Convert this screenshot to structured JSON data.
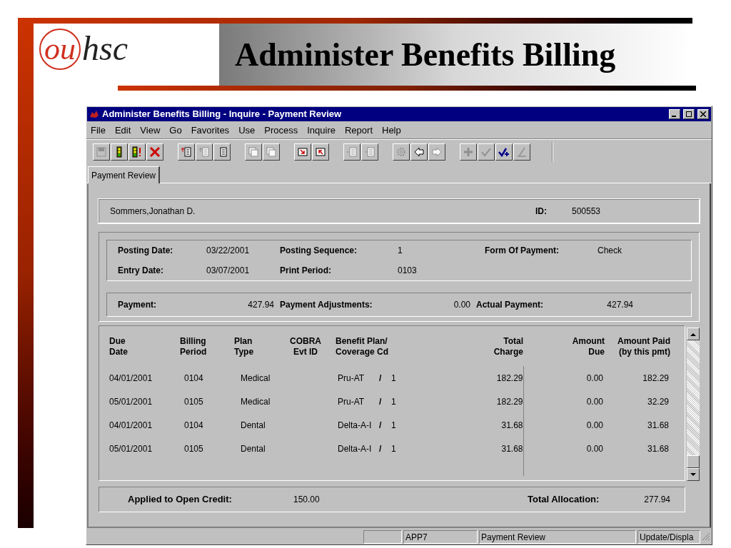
{
  "slide": {
    "logo_circle": "ou",
    "logo_text": "hsc",
    "title": "Administer Benefits Billing"
  },
  "window": {
    "title": "Administer Benefits Billing - Inquire - Payment Review"
  },
  "menu": [
    {
      "label": "File"
    },
    {
      "label": "Edit"
    },
    {
      "label": "View"
    },
    {
      "label": "Go"
    },
    {
      "label": "Favorites"
    },
    {
      "label": "Use"
    },
    {
      "label": "Process"
    },
    {
      "label": "Inquire"
    },
    {
      "label": "Report"
    },
    {
      "label": "Help"
    }
  ],
  "toolbar": [
    [
      {
        "kind": "save",
        "disabled": true
      },
      {
        "kind": "light",
        "disabled": false
      },
      {
        "kind": "light-alert",
        "disabled": false
      },
      {
        "kind": "delete",
        "disabled": false
      }
    ],
    [
      {
        "kind": "row-in",
        "disabled": false
      },
      {
        "kind": "row-out",
        "disabled": true
      },
      {
        "kind": "list",
        "disabled": false
      }
    ],
    [
      {
        "kind": "copy-in",
        "disabled": true
      },
      {
        "kind": "copy-out",
        "disabled": true
      }
    ],
    [
      {
        "kind": "down-right",
        "disabled": false
      },
      {
        "kind": "up-left",
        "disabled": false
      }
    ],
    [
      {
        "kind": "list-arrow",
        "disabled": true
      },
      {
        "kind": "list-box",
        "disabled": true
      }
    ],
    [
      {
        "kind": "gear",
        "disabled": true
      },
      {
        "kind": "left",
        "disabled": false
      },
      {
        "kind": "right",
        "disabled": true
      }
    ],
    [
      {
        "kind": "plus",
        "disabled": true
      },
      {
        "kind": "check",
        "disabled": true
      },
      {
        "kind": "check-plus",
        "disabled": false
      },
      {
        "kind": "pencil",
        "disabled": true
      }
    ]
  ],
  "tabs": [
    {
      "label": "Payment Review",
      "selected": true
    }
  ],
  "employee": {
    "name": "Sommers,Jonathan D.",
    "id_label": "ID:",
    "id": "500553"
  },
  "posting": {
    "rows": [
      [
        {
          "label": "Posting Date:",
          "value": "03/22/2001"
        },
        {
          "label": "Posting Sequence:",
          "value": "1"
        },
        {
          "label": "Form Of Payment:",
          "value": "Check"
        }
      ],
      [
        {
          "label": "Entry Date:",
          "value": "03/07/2001"
        },
        {
          "label": "Print Period:",
          "value": "0103"
        }
      ]
    ]
  },
  "payment": [
    {
      "label": "Payment:",
      "value": "427.94"
    },
    {
      "label": "Payment Adjustments:",
      "value": "0.00"
    },
    {
      "label": "Actual Payment:",
      "value": "427.94"
    }
  ],
  "table": {
    "columns": [
      [
        "Due",
        "Date"
      ],
      [
        "Billing",
        "Period"
      ],
      [
        "Plan",
        "Type"
      ],
      [
        "COBRA",
        "Evt ID"
      ],
      [
        "Benefit Plan/",
        "Coverage Cd"
      ],
      [
        "Total",
        "Charge"
      ],
      [
        "Amount",
        "Due"
      ],
      [
        "Amount Paid",
        "(by this pmt)"
      ]
    ],
    "rows": [
      {
        "due_date": "04/01/2001",
        "period": "0104",
        "plan_type": "Medical",
        "benefit_plan": "Pru-AT",
        "sep": "/",
        "coverage_cd": "1",
        "total": "182.29",
        "due": "0.00",
        "paid": "182.29"
      },
      {
        "due_date": "05/01/2001",
        "period": "0105",
        "plan_type": "Medical",
        "benefit_plan": "Pru-AT",
        "sep": "/",
        "coverage_cd": "1",
        "total": "182.29",
        "due": "0.00",
        "paid": "32.29"
      },
      {
        "due_date": "04/01/2001",
        "period": "0104",
        "plan_type": "Dental",
        "benefit_plan": "Delta-A-I",
        "sep": "/",
        "coverage_cd": "1",
        "total": "31.68",
        "due": "0.00",
        "paid": "31.68"
      },
      {
        "due_date": "05/01/2001",
        "period": "0105",
        "plan_type": "Dental",
        "benefit_plan": "Delta-A-I",
        "sep": "/",
        "coverage_cd": "1",
        "total": "31.68",
        "due": "0.00",
        "paid": "31.68"
      }
    ]
  },
  "totals": {
    "credit_label": "Applied to Open Credit:",
    "credit": "150.00",
    "allocation_label": "Total Allocation:",
    "allocation": "277.94"
  },
  "status_bar": [
    "APP7",
    "Payment Review",
    "Update/Displa"
  ]
}
